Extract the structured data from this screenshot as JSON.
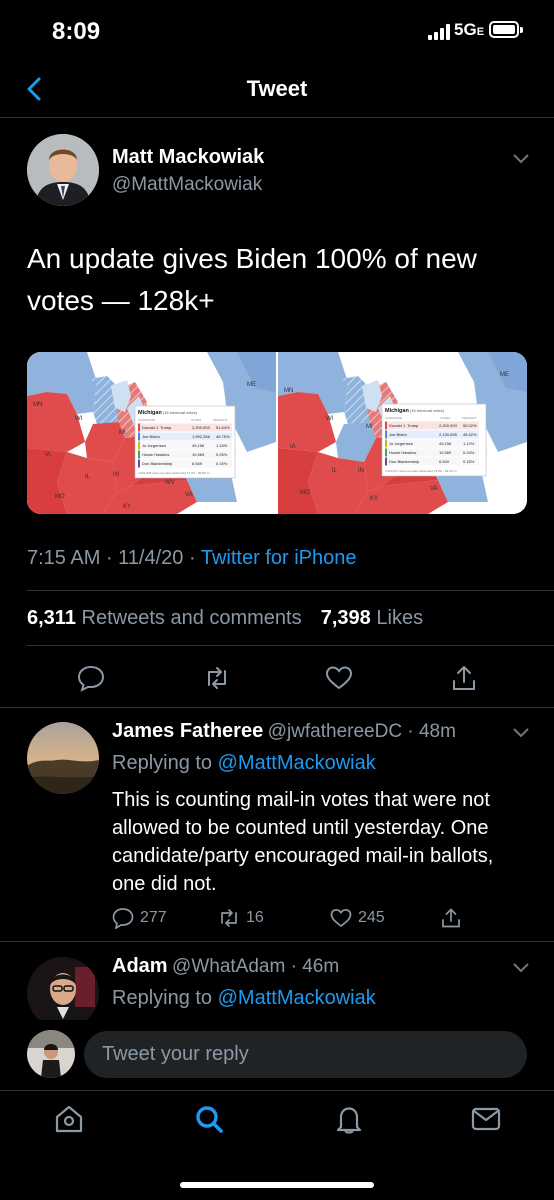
{
  "status_bar": {
    "time": "8:09",
    "network": "5G",
    "network_suffix": "E"
  },
  "header": {
    "title": "Tweet"
  },
  "tweet": {
    "author_name": "Matt Mackowiak",
    "author_handle": "@MattMackowiak",
    "text": "An update gives Biden 100% of new votes — 128k+",
    "time": "7:15 AM",
    "date": "11/4/20",
    "source": "Twitter for iPhone",
    "retweets": "6,311",
    "retweets_label": "Retweets and comments",
    "likes": "7,398",
    "likes_label": "Likes",
    "media": {
      "panels": [
        {
          "state_title": "Michigan",
          "state_sub": "(16 electoral votes)",
          "col_candidate": "CANDIDATE",
          "col_votes": "VOTES",
          "col_percent": "PERCENT",
          "rows": [
            {
              "name": "Donald J. Trump",
              "votes": "2,200,903",
              "pct": "51.64%",
              "color": "#e64545"
            },
            {
              "name": "Joe Biden",
              "votes": "1,992,356",
              "pct": "46.75%",
              "color": "#4a88d8"
            },
            {
              "name": "Jo Jorgensen",
              "votes": "49,156",
              "pct": "1.15%",
              "color": "#d9b21f"
            },
            {
              "name": "Howie Hawkins",
              "votes": "10,569",
              "pct": "0.25%",
              "color": "#3aa65a"
            },
            {
              "name": "Don Blankenship",
              "votes": "6,549",
              "pct": "0.15%",
              "color": "#7b3fa8"
            }
          ],
          "footer": "4,261,878 votes counted. Estimated 77.3% - 66.8% in",
          "map_labels": [
            "MN",
            "WI",
            "MI",
            "IA",
            "IL",
            "IN",
            "MO",
            "KY",
            "WV",
            "VA",
            "ME"
          ]
        },
        {
          "state_title": "Michigan",
          "state_sub": "(16 electoral votes)",
          "col_candidate": "CANDIDATE",
          "col_votes": "VOTES",
          "col_percent": "PERCENT",
          "rows": [
            {
              "name": "Donald J. Trump",
              "votes": "2,200,903",
              "pct": "50.02%",
              "color": "#e64545"
            },
            {
              "name": "Joe Biden",
              "votes": "2,130,695",
              "pct": "48.42%",
              "color": "#4a88d8"
            },
            {
              "name": "Jo Jorgensen",
              "votes": "49,156",
              "pct": "1.12%",
              "color": "#d9b21f"
            },
            {
              "name": "Howie Hawkins",
              "votes": "10,569",
              "pct": "0.24%",
              "color": "#3aa65a"
            },
            {
              "name": "Don Blankenship",
              "votes": "6,549",
              "pct": "0.15%",
              "color": "#7b3fa8"
            }
          ],
          "footer": "4,400,217 votes counted. Estimated 79.5% - 93.6% in",
          "map_labels": [
            "MN",
            "WI",
            "MI",
            "IA",
            "IL",
            "IN",
            "MO",
            "KY",
            "VA",
            "ME"
          ]
        }
      ]
    }
  },
  "replies": [
    {
      "name": "James Fatheree",
      "handle": "@jwfathereeDC",
      "time": "48m",
      "replying_prefix": "Replying to",
      "replying_to": "@MattMackowiak",
      "text": "This is counting mail-in votes that were not allowed to be counted until yesterday. One candidate/party encouraged mail-in ballots, one did not.",
      "comments": "277",
      "retweets": "16",
      "likes": "245"
    },
    {
      "name": "Adam",
      "handle": "@WhatAdam",
      "time": "46m",
      "replying_prefix": "Replying to",
      "replying_to": "@MattMackowiak"
    }
  ],
  "compose": {
    "placeholder": "Tweet your reply"
  },
  "tab_bar": [
    "home-icon",
    "search-icon",
    "notifications-icon",
    "messages-icon"
  ],
  "colors": {
    "accent": "#1d9bf0",
    "muted": "#8b98a5",
    "background": "#000000"
  }
}
